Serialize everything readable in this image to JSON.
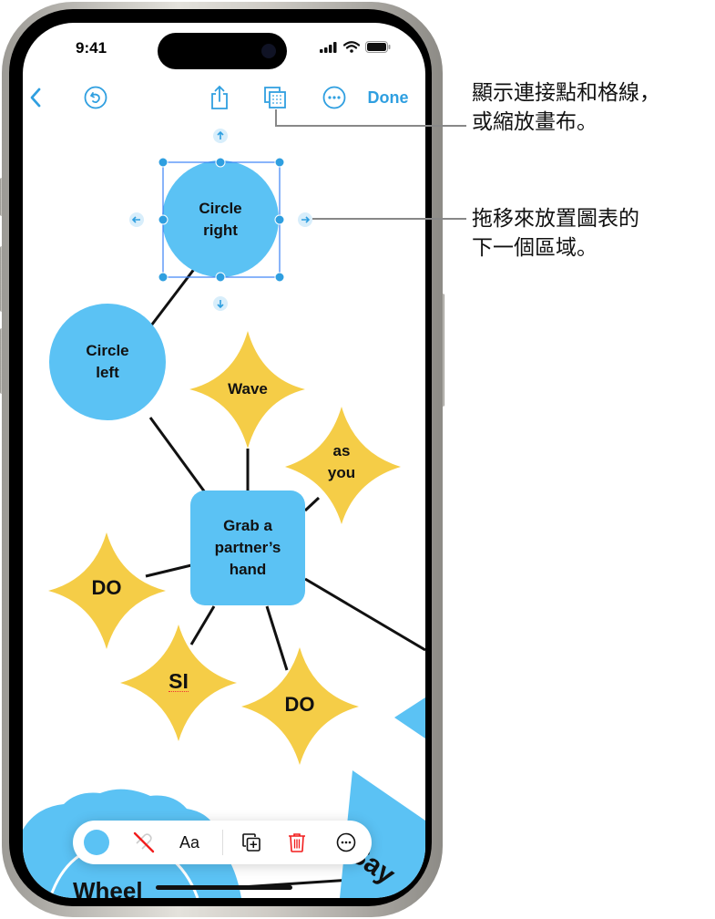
{
  "status_bar": {
    "time": "9:41",
    "icons": [
      "signal-icon",
      "wifi-icon",
      "battery-icon"
    ]
  },
  "top_toolbar": {
    "back_icon": "chevron-left-icon",
    "undo_icon": "undo-circle-icon",
    "share_icon": "share-icon",
    "grid_icon": "connection-points-grid-icon",
    "more_icon": "ellipsis-circle-icon",
    "done_label": "Done"
  },
  "canvas": {
    "selected_node": {
      "label_line1": "Circle",
      "label_line2": "right",
      "shape": "circle",
      "color": "#5bc2f4"
    },
    "nodes": [
      {
        "id": "circle-left",
        "line1": "Circle",
        "line2": "left",
        "shape": "circle",
        "color": "#5bc2f4"
      },
      {
        "id": "wave",
        "line1": "Wave",
        "line2": "",
        "shape": "star",
        "color": "#f5cd47"
      },
      {
        "id": "as-you",
        "line1": "as",
        "line2": "you",
        "shape": "star",
        "color": "#f5cd47"
      },
      {
        "id": "grab",
        "line1": "Grab a",
        "line2": "partner’s",
        "line3": "hand",
        "shape": "rounded-square",
        "color": "#5bc2f4"
      },
      {
        "id": "do-left",
        "line1": "DO",
        "shape": "star",
        "color": "#f5cd47"
      },
      {
        "id": "si",
        "line1": "SI",
        "shape": "star",
        "color": "#f5cd47"
      },
      {
        "id": "do-right",
        "line1": "DO",
        "shape": "star",
        "color": "#f5cd47"
      },
      {
        "id": "wheel",
        "line1": "Wheel",
        "shape": "cloud",
        "color": "#5bc2f4"
      },
      {
        "id": "say",
        "line1": "Say",
        "shape": "triangle",
        "color": "#5bc2f4"
      }
    ]
  },
  "bottom_toolbar": {
    "fill_icon": "fill-color-swatch-icon",
    "stroke_icon": "no-stroke-icon",
    "text_label": "Aa",
    "duplicate_icon": "duplicate-icon",
    "delete_icon": "trash-icon",
    "more_icon": "ellipsis-circle-icon"
  },
  "callouts": {
    "grid_line1": "顯示連接點和格線，",
    "grid_line2": "或縮放畫布。",
    "drag_line1": "拖移來放置圖表的",
    "drag_line2": "下一個區域。"
  },
  "colors": {
    "accent": "#2f9fe0",
    "shape_blue": "#5bc2f4",
    "shape_yellow": "#f5cd47",
    "delete_red": "#f21d1d"
  }
}
